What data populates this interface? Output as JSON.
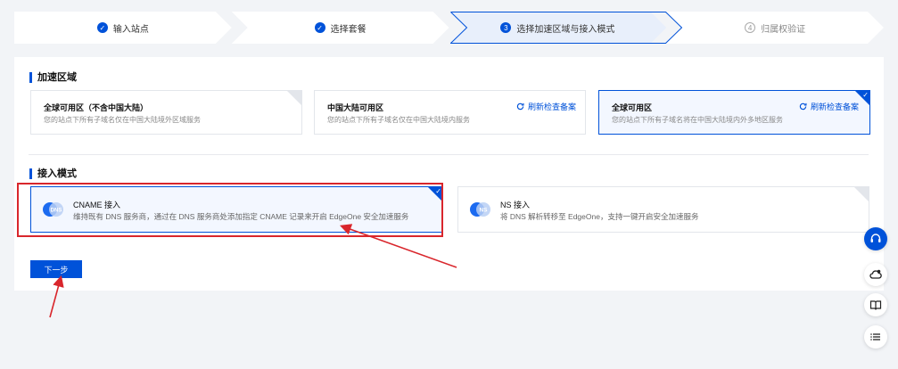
{
  "steps": [
    {
      "label": "输入站点",
      "state": "done"
    },
    {
      "label": "选择套餐",
      "state": "done"
    },
    {
      "label": "选择加速区域与接入模式",
      "state": "current",
      "num": "3"
    },
    {
      "label": "归属权验证",
      "state": "todo",
      "num": "4"
    }
  ],
  "region_section": {
    "title": "加速区域",
    "cards": [
      {
        "title": "全球可用区（不含中国大陆）",
        "desc": "您的站点下所有子域名仅在中国大陆境外区域服务",
        "selected": false
      },
      {
        "title": "中国大陆可用区",
        "desc": "您的站点下所有子域名仅在中国大陆境内服务",
        "refresh": "刷新检查备案",
        "selected": false
      },
      {
        "title": "全球可用区",
        "desc": "您的站点下所有子域名将在中国大陆境内外多地区服务",
        "refresh": "刷新检查备案",
        "selected": true
      }
    ]
  },
  "mode_section": {
    "title": "接入模式",
    "cards": [
      {
        "title": "CNAME 接入",
        "desc": "维持既有 DNS 服务商，通过在 DNS 服务商处添加指定 CNAME 记录来开启 EdgeOne 安全加速服务",
        "logo_text": "DNS",
        "selected": true
      },
      {
        "title": "NS 接入",
        "desc": "将 DNS 解析转移至 EdgeOne，支持一键开启安全加速服务",
        "logo_text": "NS",
        "selected": false
      }
    ]
  },
  "next_button": "下一步",
  "colors": {
    "primary": "#0052d9",
    "annotation": "#d9262c"
  },
  "float_icons": [
    "headset-icon",
    "cloud-user-icon",
    "book-icon",
    "list-icon"
  ]
}
